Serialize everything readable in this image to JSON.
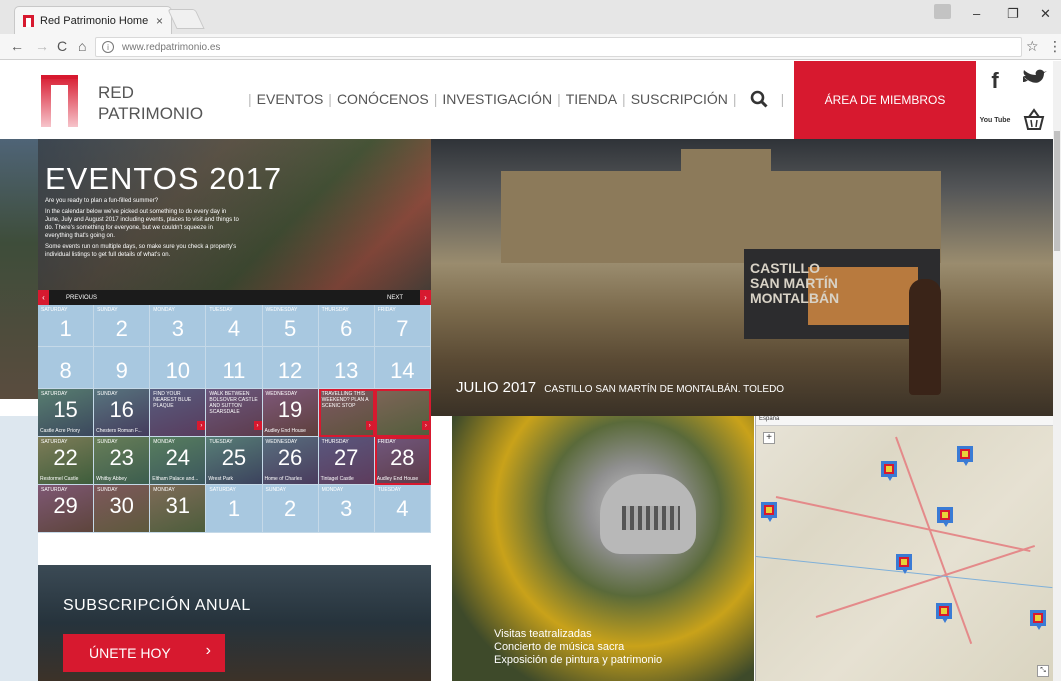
{
  "browser": {
    "tab_title": "Red Patrimonio Home P",
    "tab_close": "×",
    "url": "www.redpatrimonio.es",
    "win_min": "–",
    "win_max": "❐",
    "win_close": "✕",
    "nav_back": "←",
    "nav_forward": "→",
    "nav_reload": "C",
    "nav_home": "⌂",
    "info_glyph": "i",
    "bookmark_glyph": "☆",
    "menu_glyph": "⋮"
  },
  "site": {
    "logo_line1": "RED",
    "logo_line2": "PATRIMONIO",
    "nav": [
      "EVENTOS",
      "CONÓCENOS",
      "INVESTIGACIÓN",
      "TIENDA",
      "SUSCRIPCIÓN"
    ],
    "members_label": "ÁREA DE MIEMBROS",
    "social": {
      "facebook": "f",
      "twitter": "🐦",
      "youtube": "You Tube",
      "basket": "🧺"
    },
    "brand_color": "#d7192f"
  },
  "events": {
    "title": "EVENTOS  2017",
    "paragraphs": [
      "Are you ready to plan a fun-filled summer?",
      "In the calendar below we've picked out something to do every day in June, July and August 2017 including events, places to visit and things to do. There's something for everyone, but we couldn't squeeze in everything that's going on.",
      "Some events run on multiple days, so make sure you check a property's individual listings to get full details of what's on."
    ],
    "prev_label": "PREVIOUS",
    "next_label": "NEXT",
    "prev_arrow": "‹",
    "next_arrow": "›"
  },
  "calendar": {
    "rows": [
      [
        {
          "dow": "SATURDAY",
          "num": "1"
        },
        {
          "dow": "SUNDAY",
          "num": "2"
        },
        {
          "dow": "MONDAY",
          "num": "3"
        },
        {
          "dow": "TUESDAY",
          "num": "4"
        },
        {
          "dow": "WEDNESDAY",
          "num": "5"
        },
        {
          "dow": "THURSDAY",
          "num": "6"
        },
        {
          "dow": "FRIDAY",
          "num": "7"
        }
      ],
      [
        {
          "dow": "",
          "num": "8"
        },
        {
          "dow": "",
          "num": "9"
        },
        {
          "dow": "",
          "num": "10"
        },
        {
          "dow": "",
          "num": "11"
        },
        {
          "dow": "",
          "num": "12"
        },
        {
          "dow": "",
          "num": "13"
        },
        {
          "dow": "",
          "num": "14"
        }
      ],
      [
        {
          "dow": "SATURDAY",
          "num": "15",
          "cap": "Castle Acre Priory",
          "photo": true
        },
        {
          "dow": "SUNDAY",
          "num": "16",
          "cap": "Chesters Roman F...",
          "photo": true
        },
        {
          "desc": "FIND YOUR NEAREST BLUE PLAQUE",
          "photo": true,
          "go": true
        },
        {
          "desc": "WALK BETWEEN BOLSOVER CASTLE AND SUTTON SCARSDALE",
          "photo": true,
          "go": true
        },
        {
          "dow": "WEDNESDAY",
          "num": "19",
          "cap": "Audley End House",
          "photo": true
        },
        {
          "desc": "TRAVELLING THIS WEEKEND? PLAN A SCENIC STOP",
          "photo": true,
          "go": true,
          "hl": true
        },
        {
          "dow": "",
          "num": "",
          "photo": true,
          "go": true,
          "hl": true
        }
      ],
      [
        {
          "dow": "SATURDAY",
          "num": "22",
          "cap": "Restormel Castle",
          "photo": true
        },
        {
          "dow": "SUNDAY",
          "num": "23",
          "cap": "Whitby Abbey",
          "photo": true
        },
        {
          "dow": "MONDAY",
          "num": "24",
          "cap": "Eltham Palace and...",
          "photo": true
        },
        {
          "dow": "TUESDAY",
          "num": "25",
          "cap": "Wrest Park",
          "photo": true
        },
        {
          "dow": "WEDNESDAY",
          "num": "26",
          "cap": "Home of Charles",
          "photo": true
        },
        {
          "dow": "THURSDAY",
          "num": "27",
          "cap": "Tintagel Castle",
          "photo": true
        },
        {
          "dow": "FRIDAY",
          "num": "28",
          "cap": "Audley End House",
          "photo": true,
          "hl": true
        }
      ],
      [
        {
          "dow": "SATURDAY",
          "num": "29",
          "photo": true
        },
        {
          "dow": "SUNDAY",
          "num": "30",
          "photo": true
        },
        {
          "dow": "MONDAY",
          "num": "31",
          "photo": true
        },
        {
          "dow": "SATURDAY",
          "num": "1"
        },
        {
          "dow": "SUNDAY",
          "num": "2"
        },
        {
          "dow": "MONDAY",
          "num": "3"
        },
        {
          "dow": "TUESDAY",
          "num": "4"
        }
      ]
    ]
  },
  "hero": {
    "caption_main": "JULIO 2017",
    "caption_sub": "CASTILLO SAN MARTÍN DE MONTALBÁN. TOLEDO",
    "pavilion_text": "CASTILLO\nSAN MARTÍN\nMONTALBÁN"
  },
  "subscription": {
    "title": "SUBSCRIPCIÓN ANUAL",
    "button": "ÚNETE HOY",
    "button_chevron": "›"
  },
  "knight": {
    "lines": [
      "Visitas teatralizadas",
      "Concierto de música sacra",
      "Exposición de pintura y patrimonio"
    ]
  },
  "map": {
    "region_label": "España",
    "zoom_in": "+",
    "expand": "⤡"
  }
}
